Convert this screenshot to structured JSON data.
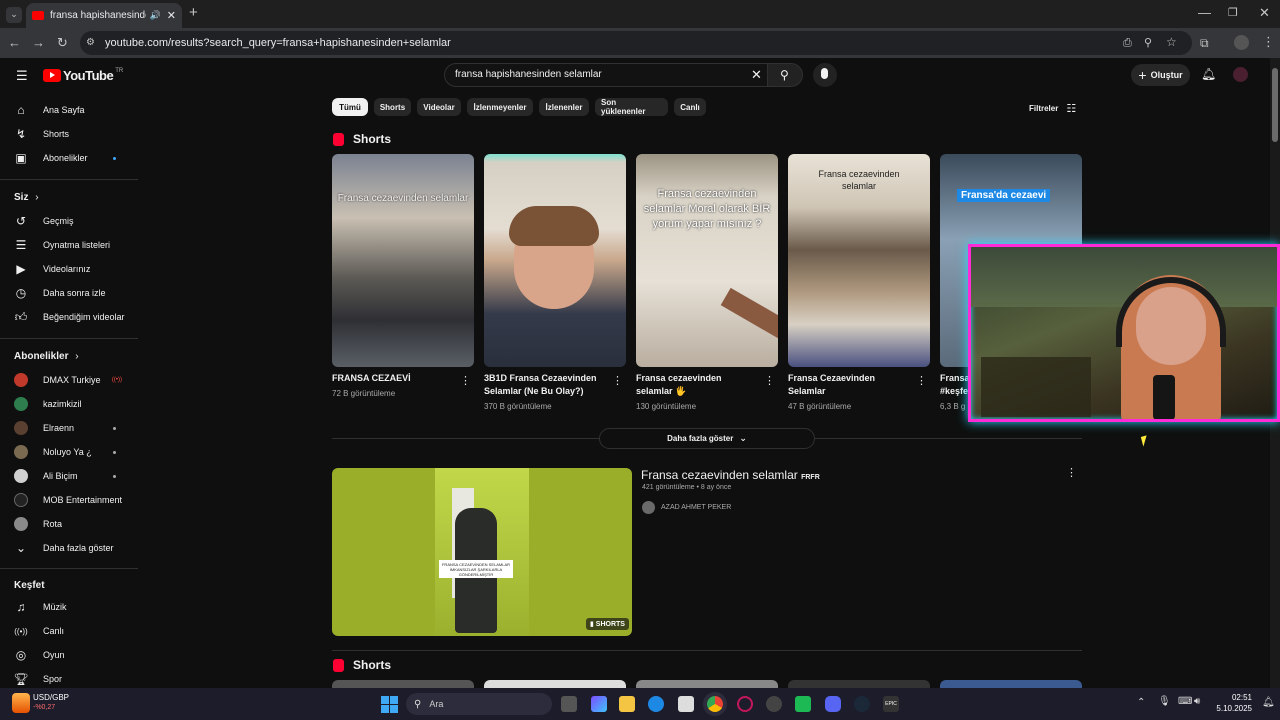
{
  "browser": {
    "tab_title": "fransa hapishanesinden selamlar",
    "url": "youtube.com/results?search_query=fransa+hapishanesinden+selamlar"
  },
  "youtube": {
    "logo": "YouTube",
    "region": "TR",
    "search_value": "fransa hapishanesinden selamlar",
    "create_label": "Oluştur",
    "filters_label": "Filtreler",
    "chips": [
      "Tümü",
      "Shorts",
      "Videolar",
      "İzlenmeyenler",
      "İzlenenler",
      "Son yüklenenler",
      "Canlı"
    ],
    "sidebar": {
      "main": [
        "Ana Sayfa",
        "Shorts",
        "Abonelikler"
      ],
      "you_header": "Siz",
      "you": [
        "Geçmiş",
        "Oynatma listeleri",
        "Videolarınız",
        "Daha sonra izle",
        "Beğendiğim videolar"
      ],
      "subs_header": "Abonelikler",
      "subs": [
        "DMAX Turkiye",
        "kazimkizil",
        "Elraenn",
        "Noluyo Ya ¿",
        "Ali Biçim",
        "MOB Entertainment",
        "Rota"
      ],
      "more": "Daha fazla göster",
      "explore_header": "Keşfet",
      "explore": [
        "Müzik",
        "Canlı",
        "Oyun",
        "Spor"
      ]
    },
    "shorts_header": "Shorts",
    "shorts": [
      {
        "title": "FRANSA CEZAEVİ",
        "views": "72 B görüntüleme",
        "overlay": "Fransa cezaevinden selamlar"
      },
      {
        "title": "3B1D Fransa Cezaevinden Selamlar (Ne Bu Olay?)",
        "views": "370 B görüntüleme",
        "overlay": ""
      },
      {
        "title": "Fransa cezaevinden selamlar 🖐",
        "views": "130 görüntüleme",
        "overlay": "Fransa cezaevinden selamlar Moral olarak BİR yorum yapar mısınız ?"
      },
      {
        "title": "Fransa Cezaevinden Selamlar",
        "views": "47 B görüntüleme",
        "overlay": "Fransa cezaevinden selamlar"
      },
      {
        "title": "Fransa",
        "title2": "#keşfe",
        "views": "6,3 B g",
        "overlay": "Fransa'da cezaevi"
      }
    ],
    "show_more": "Daha fazla göster",
    "video": {
      "title": "Fransa cezaevinden selamlar",
      "title_tag": "FRFR",
      "meta": "421 görüntüleme • 8 ay önce",
      "channel": "AZAD AHMET PEKER",
      "badge": "SHORTS",
      "sign_text": "FRANSA CEZAEVİNDEN SELAMLAR İMKANSIZLAR ŞARKILARLA GÖNDERİLMİŞTİR"
    },
    "shorts_header2": "Shorts"
  },
  "taskbar": {
    "widget_title": "USD/GBP",
    "widget_value": "-%0,27",
    "search_placeholder": "Ara",
    "time": "02:51",
    "date": "5.10.2025"
  },
  "colors": {
    "accent": "#ff0000",
    "cam_border": "#ff2bd6",
    "cam_glow": "#27d7ff"
  }
}
